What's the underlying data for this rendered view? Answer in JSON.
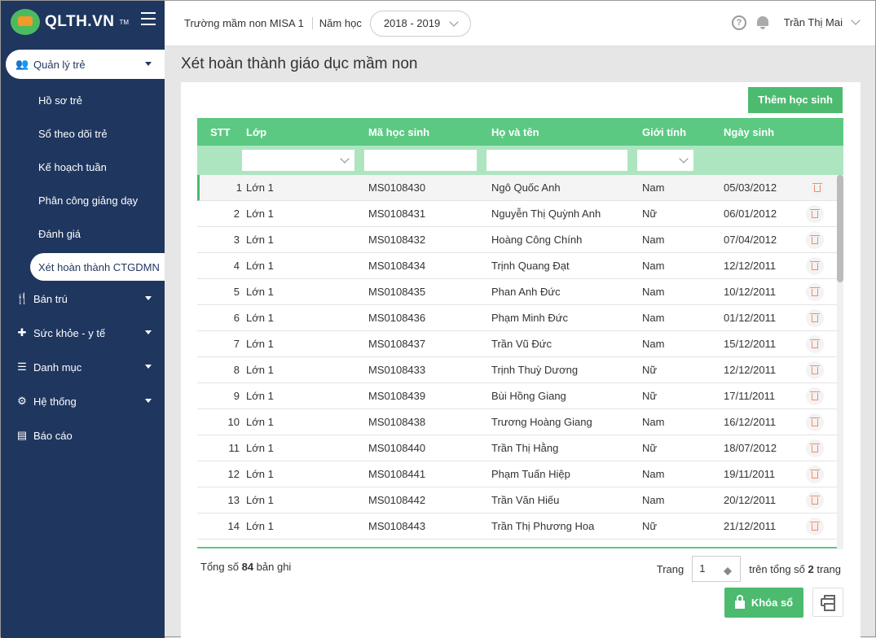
{
  "brand": {
    "name": "QLTH.VN",
    "tm": "TM"
  },
  "sidebar": {
    "items": [
      {
        "label": "Quản lý trẻ",
        "icon": "users-icon",
        "glyph": "👥",
        "expanded": true,
        "children": [
          {
            "label": "Hồ sơ trẻ"
          },
          {
            "label": "Sổ theo dõi trẻ"
          },
          {
            "label": "Kế hoạch tuần"
          },
          {
            "label": "Phân công giảng dạy"
          },
          {
            "label": "Đánh giá"
          },
          {
            "label": "Xét hoàn thành CTGDMN",
            "active": true
          }
        ]
      },
      {
        "label": "Bán trú",
        "icon": "utensils-icon",
        "glyph": "🍴",
        "caret": true
      },
      {
        "label": "Sức khỏe - y tế",
        "icon": "medkit-icon",
        "glyph": "✚",
        "caret": true
      },
      {
        "label": "Danh mục",
        "icon": "list-icon",
        "glyph": "☰",
        "caret": true
      },
      {
        "label": "Hệ thống",
        "icon": "gear-icon",
        "glyph": "⚙",
        "caret": true
      },
      {
        "label": "Báo cáo",
        "icon": "report-icon",
        "glyph": "▤",
        "caret": false
      }
    ]
  },
  "topbar": {
    "school": "Trường mầm non MISA 1",
    "year_label": "Năm học",
    "year": "2018 - 2019",
    "help": "?",
    "user": "Trần Thị Mai"
  },
  "page": {
    "title": "Xét hoàn thành giáo dục mầm non",
    "add_button": "Thêm học sinh"
  },
  "table": {
    "columns": [
      "STT",
      "Lớp",
      "Mã học sinh",
      "Họ và tên",
      "Giới tính",
      "Ngày sinh"
    ],
    "rows": [
      [
        "1",
        "Lớn 1",
        "MS0108430",
        "Ngô Quốc Anh",
        "Nam",
        "05/03/2012"
      ],
      [
        "2",
        "Lớn 1",
        "MS0108431",
        "Nguyễn Thị Quỳnh Anh",
        "Nữ",
        "06/01/2012"
      ],
      [
        "3",
        "Lớn 1",
        "MS0108432",
        "Hoàng Công Chính",
        "Nam",
        "07/04/2012"
      ],
      [
        "4",
        "Lớn 1",
        "MS0108434",
        "Trịnh Quang Đạt",
        "Nam",
        "12/12/2011"
      ],
      [
        "5",
        "Lớn 1",
        "MS0108435",
        "Phan Anh Đức",
        "Nam",
        "10/12/2011"
      ],
      [
        "6",
        "Lớn 1",
        "MS0108436",
        "Phạm Minh Đức",
        "Nam",
        "01/12/2011"
      ],
      [
        "7",
        "Lớn 1",
        "MS0108437",
        "Trần Vũ Đức",
        "Nam",
        "15/12/2011"
      ],
      [
        "8",
        "Lớn 1",
        "MS0108433",
        "Trịnh Thuỳ Dương",
        "Nữ",
        "12/12/2011"
      ],
      [
        "9",
        "Lớn 1",
        "MS0108439",
        "Bùi Hồng Giang",
        "Nữ",
        "17/11/2011"
      ],
      [
        "10",
        "Lớn 1",
        "MS0108438",
        "Trương Hoàng Giang",
        "Nam",
        "16/12/2011"
      ],
      [
        "11",
        "Lớn 1",
        "MS0108440",
        "Trần Thị Hằng",
        "Nữ",
        "18/07/2012"
      ],
      [
        "12",
        "Lớn 1",
        "MS0108441",
        "Phạm Tuấn Hiệp",
        "Nam",
        "19/11/2011"
      ],
      [
        "13",
        "Lớn 1",
        "MS0108442",
        "Trần Văn Hiếu",
        "Nam",
        "20/12/2011"
      ],
      [
        "14",
        "Lớn 1",
        "MS0108443",
        "Trần Thị Phương Hoa",
        "Nữ",
        "21/12/2011"
      ]
    ]
  },
  "footer": {
    "total_prefix": "Tổng số ",
    "total": "84",
    "total_suffix": " bản ghi",
    "page_label": "Trang",
    "page": "1",
    "of_prefix": "trên tổng số ",
    "pages": "2",
    "of_suffix": " trang",
    "lock_button": "Khóa sổ"
  },
  "colors": {
    "sidebar": "#1f365f",
    "accent": "#4cbb6f",
    "header": "#5bc982",
    "filter": "#ade5c1"
  }
}
